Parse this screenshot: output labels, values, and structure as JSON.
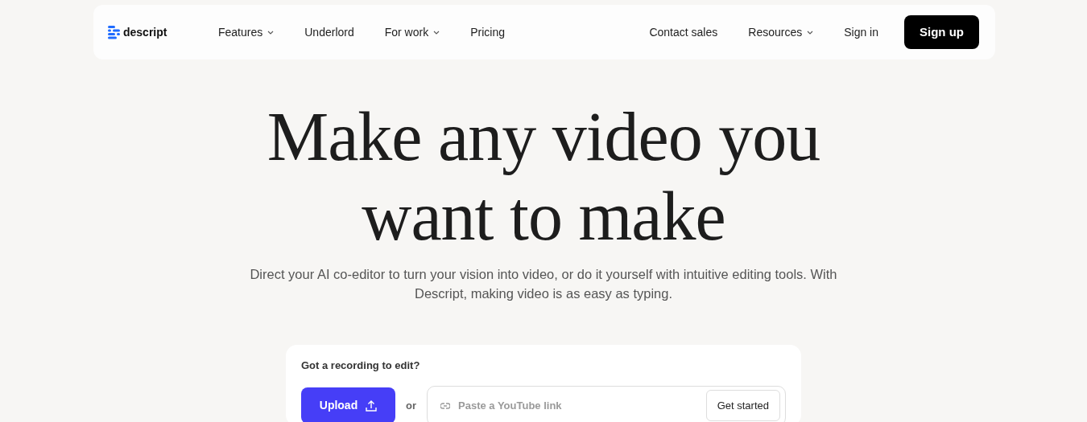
{
  "brand": {
    "name": "descript"
  },
  "nav_left": [
    {
      "label": "Features",
      "has_menu": true
    },
    {
      "label": "Underlord",
      "has_menu": false
    },
    {
      "label": "For work",
      "has_menu": true
    },
    {
      "label": "Pricing",
      "has_menu": false
    }
  ],
  "nav_right": [
    {
      "label": "Contact sales",
      "has_menu": false
    },
    {
      "label": "Resources",
      "has_menu": true
    },
    {
      "label": "Sign in",
      "has_menu": false
    }
  ],
  "signup_button": "Sign up",
  "hero": {
    "headline_lines": [
      "Make any video you",
      "want to make"
    ],
    "subtitle": "Direct your AI co-editor to turn your vision into video, or do it yourself with intuitive editing tools. With Descript, making video is as easy as typing."
  },
  "upload_card": {
    "title": "Got a recording to edit?",
    "upload_button": "Upload",
    "separator": "or",
    "link_field": {
      "placeholder": "Paste a YouTube link"
    },
    "submit_button": "Get started"
  }
}
